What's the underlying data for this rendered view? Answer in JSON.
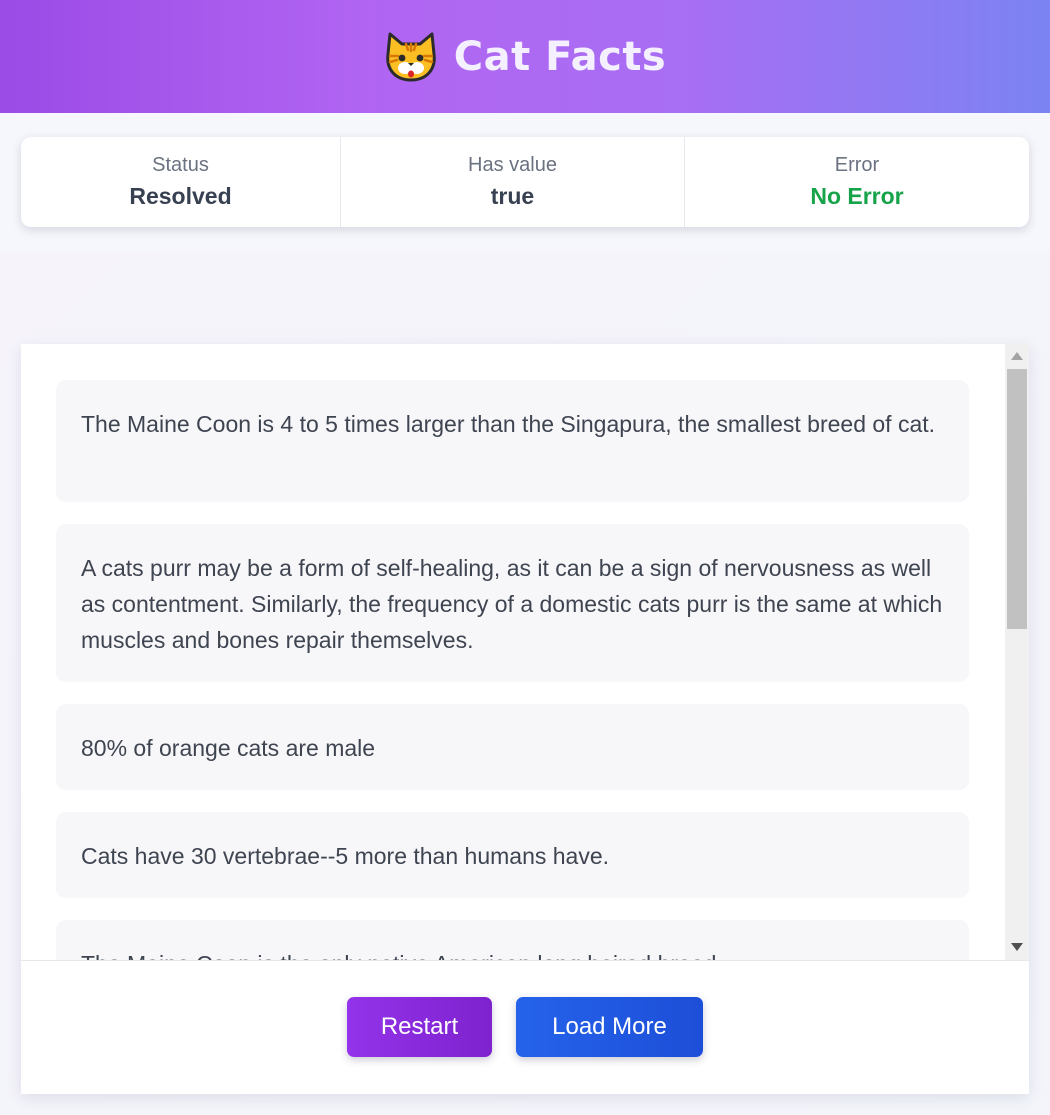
{
  "header": {
    "title": "Cat Facts",
    "logo_icon": "cat-face-icon"
  },
  "status": {
    "status_label": "Status",
    "status_value": "Resolved",
    "has_value_label": "Has value",
    "has_value_value": "true",
    "error_label": "Error",
    "error_value": "No Error"
  },
  "facts": [
    "The Maine Coon is 4 to 5 times larger than the Singapura, the smallest breed of cat.",
    "A cats purr may be a form of self-healing, as it can be a sign of nervousness as well as contentment. Similarly, the frequency of a domestic cats purr is the same at which muscles and bones repair themselves.",
    "80% of orange cats are male",
    "Cats have 30 vertebrae--5 more than humans have.",
    "The Maine Coon is the only native American long haired breed."
  ],
  "buttons": {
    "restart": "Restart",
    "load_more": "Load More"
  },
  "colors": {
    "header_gradient_start": "#9b4be6",
    "header_gradient_end": "#7b83f2",
    "success": "#16a34a",
    "restart_button": "#9333ea",
    "load_more_button": "#2563eb"
  }
}
